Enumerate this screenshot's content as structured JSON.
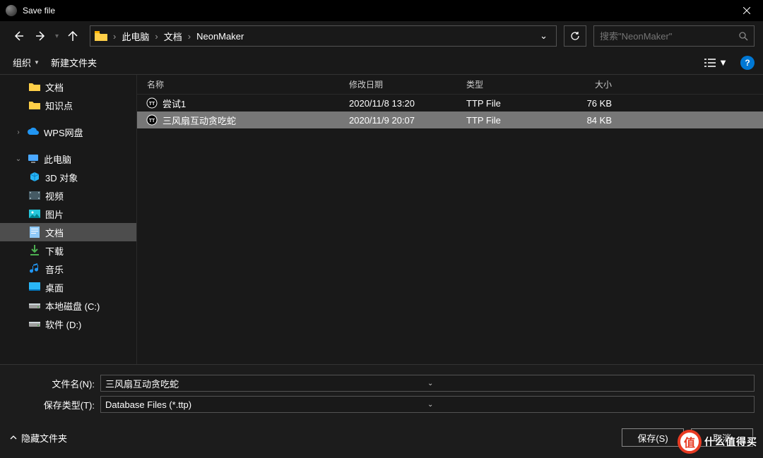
{
  "title": "Save file",
  "breadcrumbs": [
    "此电脑",
    "文档",
    "NeonMaker"
  ],
  "search_placeholder": "搜索\"NeonMaker\"",
  "toolbar": {
    "organize": "组织",
    "newfolder": "新建文件夹"
  },
  "columns": {
    "name": "名称",
    "date": "修改日期",
    "type": "类型",
    "size": "大小"
  },
  "sidebar": {
    "items": [
      {
        "label": "文档",
        "level": 2,
        "kind": "folder-yellow"
      },
      {
        "label": "知识点",
        "level": 2,
        "kind": "folder-yellow"
      },
      {
        "label": "WPS网盘",
        "level": 1,
        "kind": "cloud",
        "expandable": true
      },
      {
        "label": "此电脑",
        "level": 1,
        "kind": "pc",
        "expandable": true,
        "expanded": true
      },
      {
        "label": "3D 对象",
        "level": 2,
        "kind": "3d"
      },
      {
        "label": "视频",
        "level": 2,
        "kind": "video"
      },
      {
        "label": "图片",
        "level": 2,
        "kind": "pictures"
      },
      {
        "label": "文档",
        "level": 2,
        "kind": "docs",
        "selected": true
      },
      {
        "label": "下载",
        "level": 2,
        "kind": "downloads"
      },
      {
        "label": "音乐",
        "level": 2,
        "kind": "music"
      },
      {
        "label": "桌面",
        "level": 2,
        "kind": "desktop"
      },
      {
        "label": "本地磁盘 (C:)",
        "level": 2,
        "kind": "drive"
      },
      {
        "label": "软件 (D:)",
        "level": 2,
        "kind": "drive"
      }
    ]
  },
  "files": [
    {
      "name": "尝试1",
      "date": "2020/11/8 13:20",
      "type": "TTP File",
      "size": "76 KB",
      "selected": false
    },
    {
      "name": "三风扇互动贪吃蛇",
      "date": "2020/11/9 20:07",
      "type": "TTP File",
      "size": "84 KB",
      "selected": true
    }
  ],
  "filename_label": "文件名(N):",
  "filetype_label": "保存类型(T):",
  "filename_value": "三风扇互动贪吃蛇",
  "filetype_value": "Database Files (*.ttp)",
  "hide_folders": "隐藏文件夹",
  "save_label": "保存(S)",
  "cancel_label": "取消",
  "watermark": "什么值得买"
}
